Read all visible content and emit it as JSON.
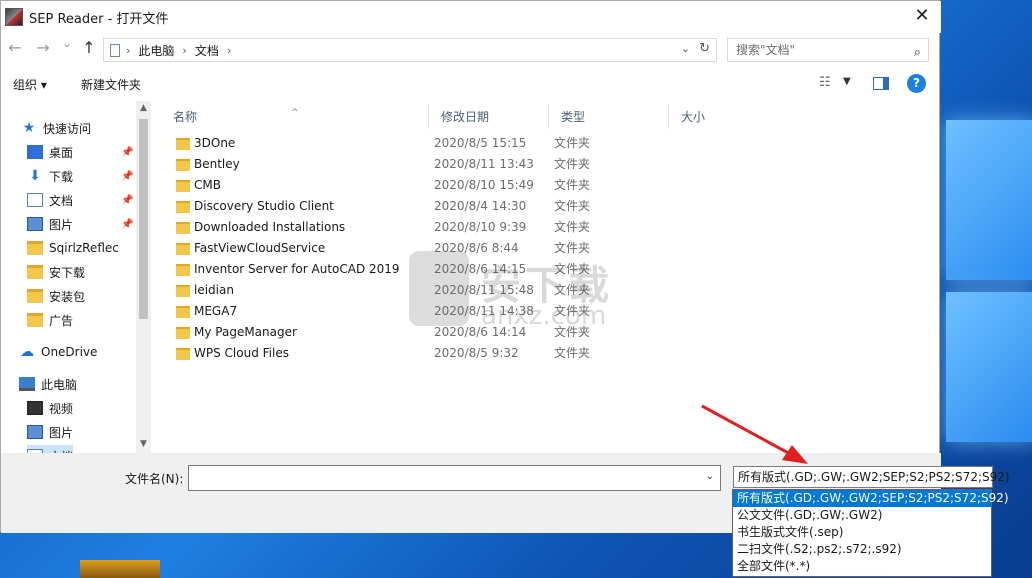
{
  "window": {
    "title": "SEP Reader - 打开文件",
    "close_glyph": "✕"
  },
  "navigation": {
    "back_glyph": "←",
    "forward_glyph": "→",
    "recent_glyph": "⌄",
    "up_glyph": "↑",
    "breadcrumb": [
      "此电脑",
      "文档"
    ],
    "search_placeholder": "搜索\"文档\""
  },
  "toolbar": {
    "organize_label": "组织 ▾",
    "new_folder_label": "新建文件夹",
    "help_label": "?"
  },
  "sidebar": {
    "items": [
      {
        "label": "快速访问",
        "icon": "star-icon",
        "pinned": false
      },
      {
        "label": "桌面",
        "icon": "desktop-icon",
        "pinned": true
      },
      {
        "label": "下载",
        "icon": "download-icon",
        "pinned": true
      },
      {
        "label": "文档",
        "icon": "document-icon",
        "pinned": true
      },
      {
        "label": "图片",
        "icon": "picture-icon",
        "pinned": true
      },
      {
        "label": "SqirlzReflec",
        "icon": "folder-icon",
        "pinned": false
      },
      {
        "label": "安下载",
        "icon": "folder-icon",
        "pinned": false
      },
      {
        "label": "安装包",
        "icon": "folder-icon",
        "pinned": false
      },
      {
        "label": "广告",
        "icon": "folder-icon",
        "pinned": false
      },
      {
        "label": "OneDrive",
        "icon": "cloud-icon",
        "pinned": false
      },
      {
        "label": "此电脑",
        "icon": "computer-icon",
        "pinned": false
      },
      {
        "label": "视频",
        "icon": "video-icon",
        "pinned": false
      },
      {
        "label": "图片",
        "icon": "picture-icon",
        "pinned": false
      },
      {
        "label": "文档",
        "icon": "document-icon",
        "pinned": false
      }
    ]
  },
  "file_list": {
    "columns": [
      "名称",
      "修改日期",
      "类型",
      "大小"
    ],
    "rows": [
      {
        "name": "3DOne",
        "date": "2020/8/5 15:15",
        "type": "文件夹"
      },
      {
        "name": "Bentley",
        "date": "2020/8/11 13:43",
        "type": "文件夹"
      },
      {
        "name": "CMB",
        "date": "2020/8/10 15:49",
        "type": "文件夹"
      },
      {
        "name": "Discovery Studio Client",
        "date": "2020/8/4 14:30",
        "type": "文件夹"
      },
      {
        "name": "Downloaded Installations",
        "date": "2020/8/10 9:39",
        "type": "文件夹"
      },
      {
        "name": "FastViewCloudService",
        "date": "2020/8/6 8:44",
        "type": "文件夹"
      },
      {
        "name": "Inventor Server for AutoCAD 2019",
        "date": "2020/8/6 14:15",
        "type": "文件夹"
      },
      {
        "name": "leidian",
        "date": "2020/8/11 15:48",
        "type": "文件夹"
      },
      {
        "name": "MEGA7",
        "date": "2020/8/11 14:38",
        "type": "文件夹"
      },
      {
        "name": "My PageManager",
        "date": "2020/8/6 14:14",
        "type": "文件夹"
      },
      {
        "name": "WPS Cloud Files",
        "date": "2020/8/5 9:32",
        "type": "文件夹"
      }
    ]
  },
  "watermark": {
    "text1": "安下载",
    "text2": "anxz.com"
  },
  "bottom": {
    "filename_label": "文件名(N):",
    "filename_value": "",
    "filetype_selected": "所有版式(.GD;.GW;.GW2;SEP;S2;PS2;S72;S92)",
    "filetype_options": [
      "所有版式(.GD;.GW;.GW2;SEP;S2;PS2;S72;S92)",
      "公文文件(.GD;.GW;.GW2)",
      "书生版式文件(.sep)",
      "二扫文件(.S2;.ps2;.s72;.s92)",
      "全部文件(*.*)"
    ],
    "selected_option_index": 0
  },
  "colors": {
    "accent": "#0078d7",
    "annotation_arrow": "#e02020"
  }
}
